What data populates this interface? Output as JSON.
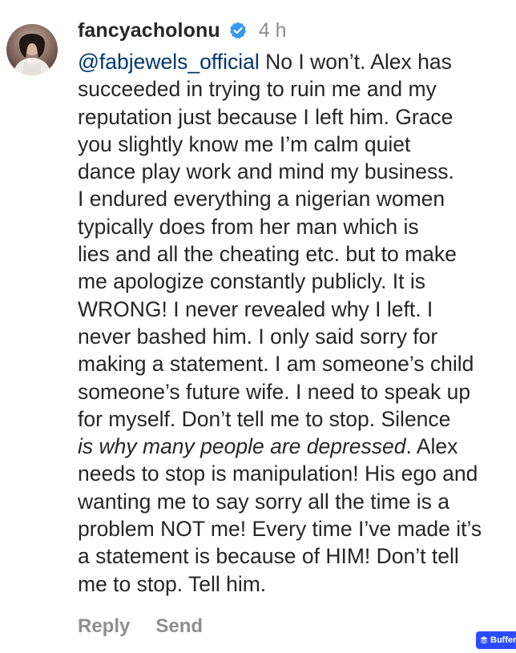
{
  "comment": {
    "username": "fancyacholonu",
    "verified_icon": "verified-badge-icon",
    "time_ago": "4 h",
    "mention": "@fabjewels_official",
    "lines": [
      " No I won’t. Alex has",
      "succeeded in trying to ruin me and my",
      "reputation just because I left him. Grace",
      "you slightly know me I’m calm quiet",
      "dance play work and mind my business.",
      "I endured everything a nigerian women",
      "typically does from her man which is",
      "lies and all the cheating etc. but to make",
      "me apologize constantly publicly. It is",
      "WRONG! I never revealed why I left. I",
      "never bashed him. I only said sorry for",
      "making a statement. I am someone’s child",
      "someone’s future wife. I need to speak up",
      "for myself. Don’t tell me to stop. Silence",
      "is why many people are depressed",
      ". Alex",
      "needs to stop is manipulation! His ego and",
      "wanting me to say sorry all the time is a",
      "problem NOT me! Every time I’ve made it’s",
      "a statement is because of HIM! Don’t tell",
      "me to stop. Tell him."
    ],
    "actions": {
      "reply": "Reply",
      "send": "Send"
    }
  },
  "overlay": {
    "buffer_label": "Buffer",
    "buffer_color": "#2c4bff"
  },
  "colors": {
    "mention": "#00376b",
    "verified": "#3897f0",
    "meta_gray": "#8e8e8e",
    "text": "#262626"
  }
}
